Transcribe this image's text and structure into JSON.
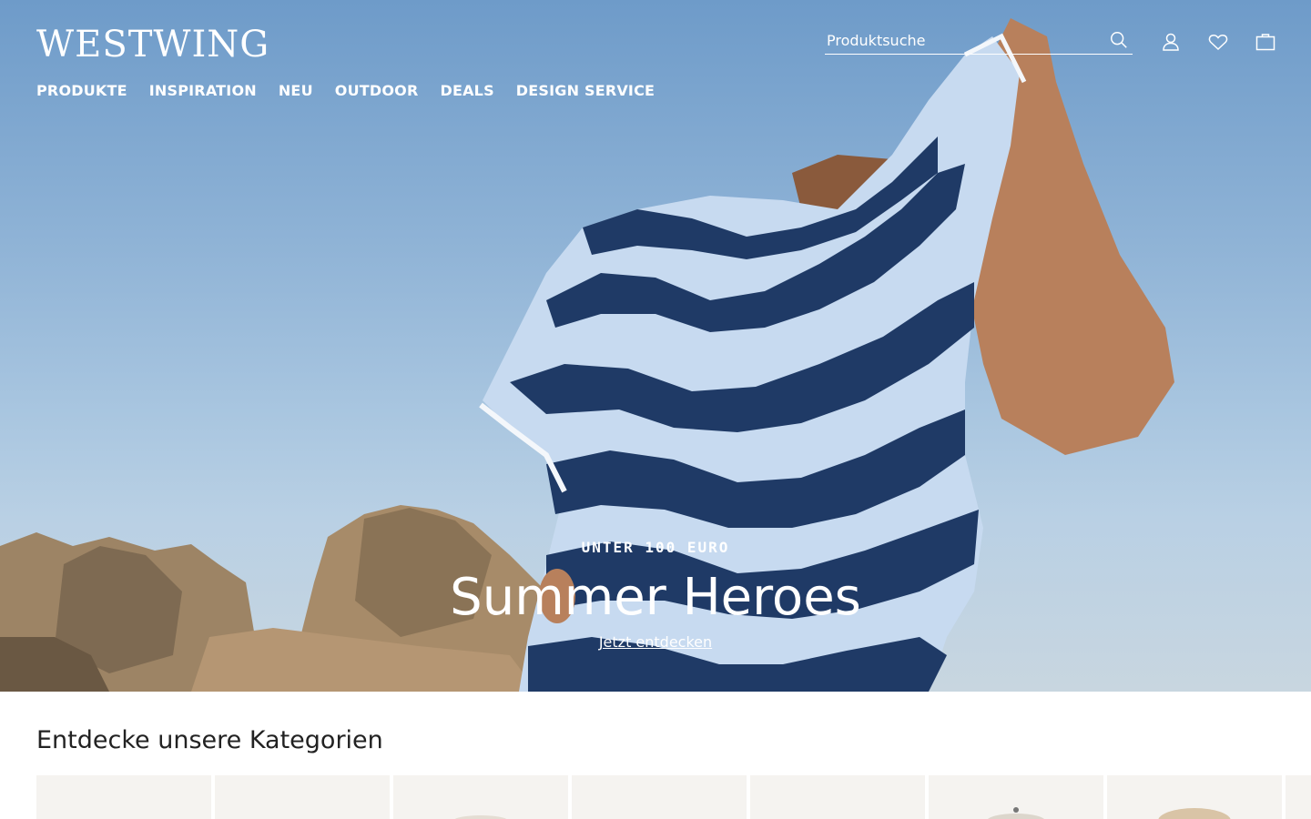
{
  "brand": {
    "logo_text": "WESTWING"
  },
  "nav": {
    "items": [
      "PRODUKTE",
      "INSPIRATION",
      "NEU",
      "OUTDOOR",
      "DEALS",
      "DESIGN SERVICE"
    ]
  },
  "search": {
    "placeholder": "Produktsuche",
    "value": ""
  },
  "header_icons": [
    "search-icon",
    "account-icon",
    "wishlist-icon",
    "cart-icon"
  ],
  "hero": {
    "eyebrow": "UNTER 100 EURO",
    "headline": "Summer Heroes",
    "cta": "Jetzt entdecken"
  },
  "categories": {
    "title": "Entdecke unsere Kategorien",
    "card_count_visible": 8
  },
  "colors": {
    "header_text": "#ffffff",
    "towel_navy": "#1f3a66",
    "towel_light": "#c7daf0",
    "sky": "#8fb3d6"
  }
}
